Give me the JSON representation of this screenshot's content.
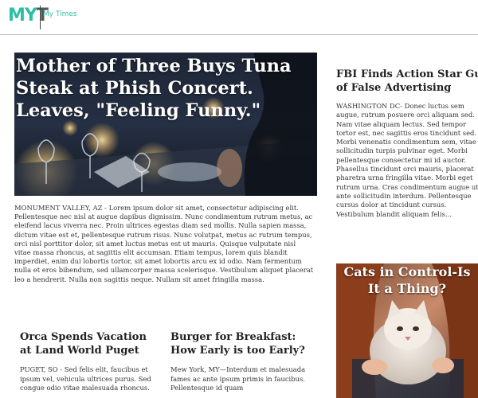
{
  "header": {
    "logo_part1": "MY",
    "logo_part2": "T",
    "site_name": "My Times"
  },
  "hero": {
    "title": "Mother of Three Buys Tuna Steak at Phish Concert. Leaves, \"Feeling Funny.\"",
    "image_desc": "dinner-table-photo",
    "body": "MONUMENT VALLEY, AZ - Lorem ipsum dolor sit amet, consectetur adipiscing elit. Pellentesque nec nisl at augue dapibus dignissim. Nunc condimentum rutrum metus, ac eleifend lacus viverra nec. Proin ultrices egestas diam sed mollis. Nulla sapien massa, dictum vitae est et, pellentesque rutrum risus. Nunc volutpat, metus ac rutrum tempus, orci nisl porttitor dolor, sit amet luctus metus est ut mauris. Quisque vulputate nisl vitae massa rhoncus, at sagittis elit accumsan. Etiam tempus, lorem quis blandit imperdiet, enim dui lobortis tortor, sit amet lobortis arcu ex id odio. Nam fermentum nulla et eros bibendum, sed ullamcorper massa scelerisque. Vestibulum aliquet placerat leo a hendrerit. Nulla non sagittis neque. Nullam sit amet fringilla massa."
  },
  "bottom_articles": [
    {
      "title": "Orca Spends Vacation at Land World Puget",
      "body": "PUGET, SO - Sed felis elit, faucibus et ipsum vel, vehicula ultrices purus. Sed congue odio vitae malesuada rhoncus."
    },
    {
      "title": "Burger for Breakfast: How Early is too Early?",
      "body": "Mew York, MY—Interdum et malesuada fames ac ante ipsum primis in faucibus. Pellentesque id quam"
    }
  ],
  "side_article": {
    "title_line1": "FBI Finds Action Star Guilty",
    "title_line2": "of False Advertising",
    "body": "WASHINGTON DC- Donec luctus sem augue, rutrum posuere orci aliquam sed. Nam vitae aliquam lectus. Sed tempor tortor est, nec sagittis eros tincidunt sed. Morbi venenatis condimentum sem, vitae sollicitudin turpis pulvinar eget. Morbi pellentesque consectetur mi id auctor. Phasellus tincidunt orci mauris, placerat pharetra urna fringilla vitae. Morbi eget rutrum urna. Cras condimentum augue ut ante sollicitudin interdum. Pellentesque cursus dolor at tincidunt cursus. Vestibulum blandit aliquam felis..."
  },
  "cats_card": {
    "title": "Cats in Control-Is It a Thing?",
    "image_desc": "cat-photo"
  }
}
